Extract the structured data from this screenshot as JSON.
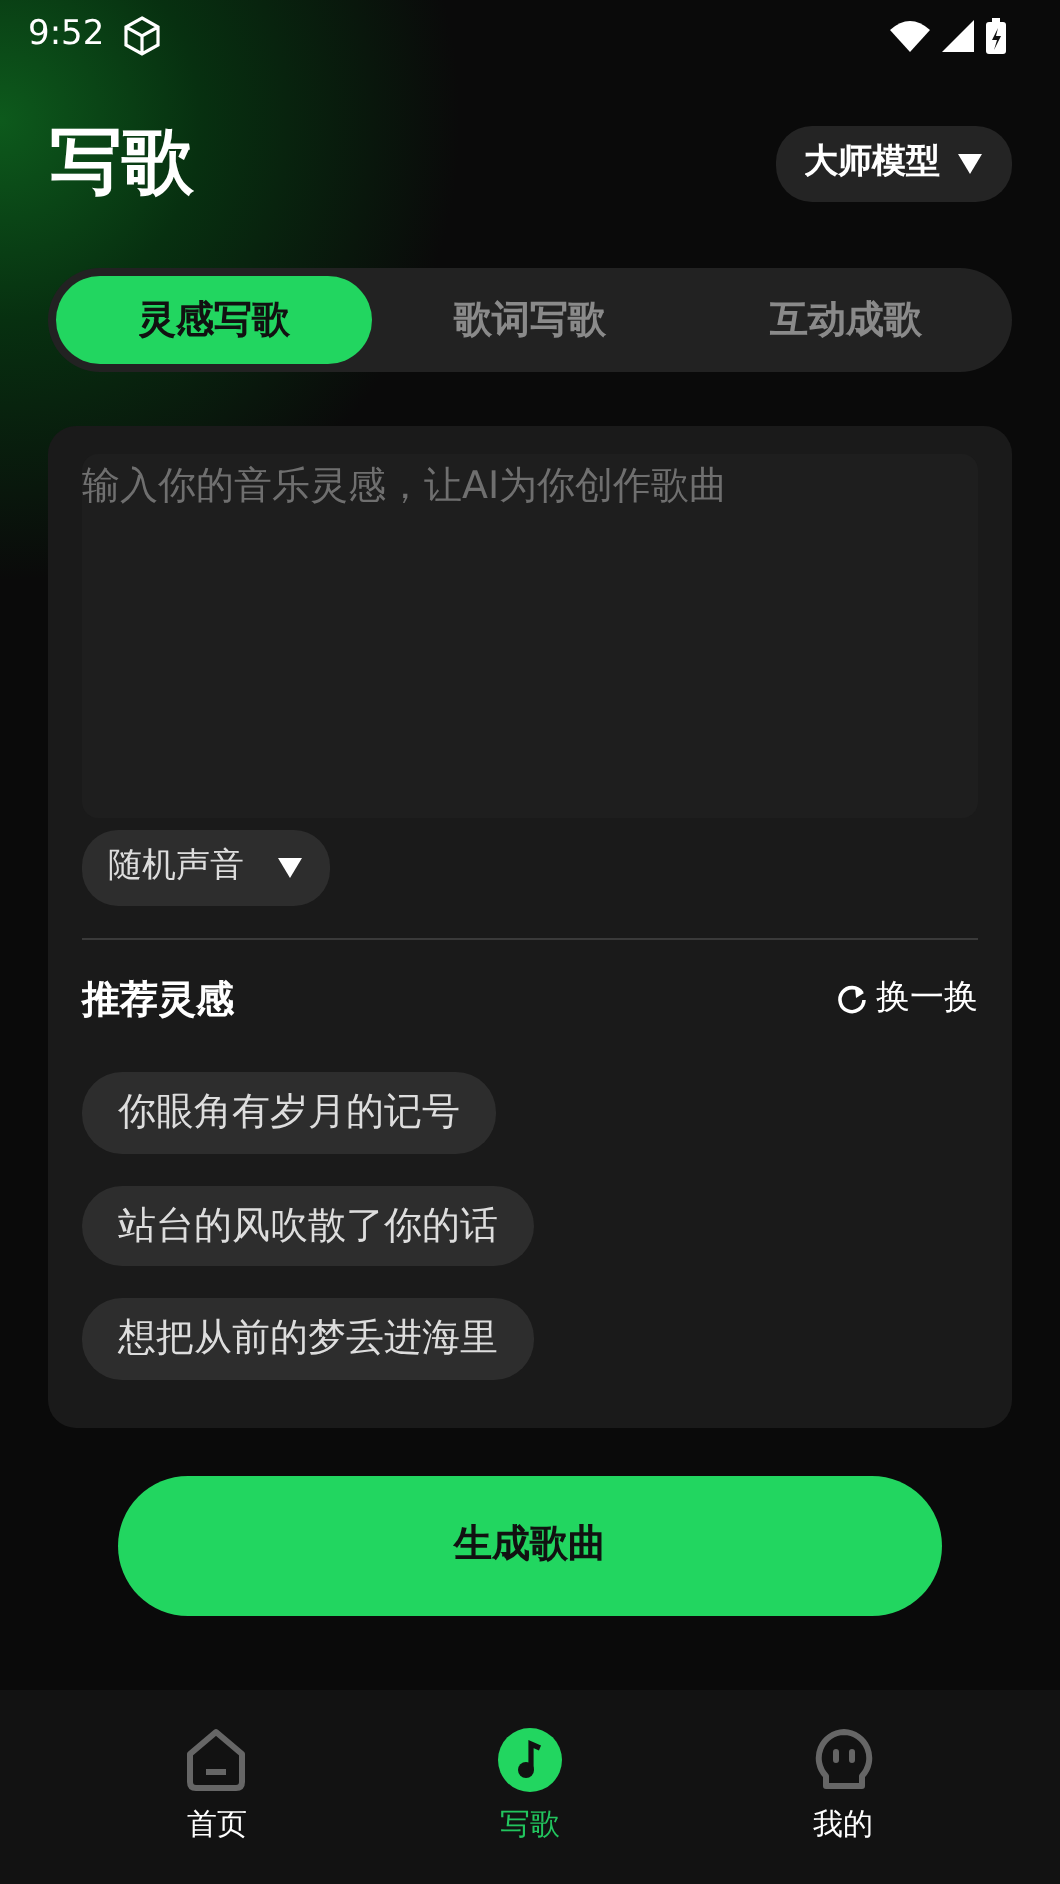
{
  "status_bar": {
    "time": "9:52"
  },
  "header": {
    "title": "写歌",
    "model_button": "大师模型"
  },
  "tabs": [
    {
      "label": "灵感写歌",
      "selected": true
    },
    {
      "label": "歌词写歌",
      "selected": false
    },
    {
      "label": "互动成歌",
      "selected": false
    }
  ],
  "prompt": {
    "placeholder": "输入你的音乐灵感，让AI为你创作歌曲",
    "voice_select": "随机声音"
  },
  "inspiration": {
    "title": "推荐灵感",
    "refresh": "换一换",
    "suggestions": [
      "你眼角有岁月的记号",
      "站台的风吹散了你的话",
      "想把从前的梦丢进海里"
    ]
  },
  "generate_button": "生成歌曲",
  "bottom_nav": [
    {
      "label": "首页",
      "kind": "home",
      "selected": false
    },
    {
      "label": "写歌",
      "kind": "music",
      "selected": true
    },
    {
      "label": "我的",
      "kind": "profile",
      "selected": false
    }
  ]
}
